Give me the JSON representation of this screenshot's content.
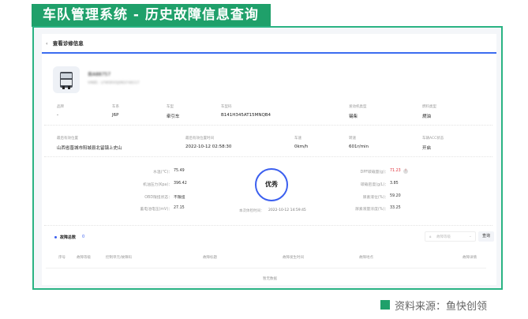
{
  "title": "车队管理系统 - 历史故障信息查询",
  "header": {
    "back": "‹",
    "title": "查看诊修信息"
  },
  "vehicle": {
    "plate": "晋A88757",
    "vin": "VIN码：LFWSRXSJ0N1F48117"
  },
  "row1": [
    {
      "label": "品牌",
      "value": "-"
    },
    {
      "label": "车系",
      "value": "J6P"
    },
    {
      "label": "车型",
      "value": "牵引车"
    },
    {
      "label": "车型码",
      "value": "B141H345AT15MNQB4"
    },
    {
      "label": "发动机类型",
      "value": "锡柴"
    },
    {
      "label": "燃料类型",
      "value": "燃油"
    }
  ],
  "row2": [
    {
      "label": "最后有效位置",
      "value": "山西省晋城市阳城县北留镇上史山"
    },
    {
      "label": "最后有效位置时间",
      "value": "2022-10-12 02:58:30"
    },
    {
      "label": "车速",
      "value": "0km/h"
    },
    {
      "label": "转速",
      "value": "601r/min"
    },
    {
      "label": "车辆ACC状态",
      "value": "开启"
    }
  ],
  "left_metrics": [
    {
      "label": "水温(°C)：",
      "value": "75.49"
    },
    {
      "label": "机油压力(Kpa)：",
      "value": "396.42"
    },
    {
      "label": "OBD限扭状态：",
      "value": "不限扭"
    },
    {
      "label": "蓄电池电压(mV)：",
      "value": "27.15"
    }
  ],
  "right_metrics": [
    {
      "label": "DPF碳载量(g)：",
      "value": "71.23"
    },
    {
      "label": "碳载密度(g/L)：",
      "value": "3.85"
    },
    {
      "label": "尿素液位(%)：",
      "value": "59.20"
    },
    {
      "label": "尿素液量浓度(%)：",
      "value": "33.25"
    }
  ],
  "health": {
    "grade": "优秀",
    "time_label": "本次体检时间：",
    "time": "2022-10-12 14:59:45"
  },
  "faults": {
    "title": "故障总数",
    "count": "0",
    "select_placeholder": "故障等级",
    "query": "查询",
    "columns": [
      "序号",
      "故障等级",
      "控制单元/故障码",
      "故障标题",
      "故障发生时间",
      "故障地点",
      "故障详情"
    ],
    "empty": "暂无数据"
  },
  "source": "资料来源：鱼快创领",
  "colors": {
    "accent": "#3b5fef",
    "brand": "#1fa06a",
    "alert": "#e0323c"
  }
}
